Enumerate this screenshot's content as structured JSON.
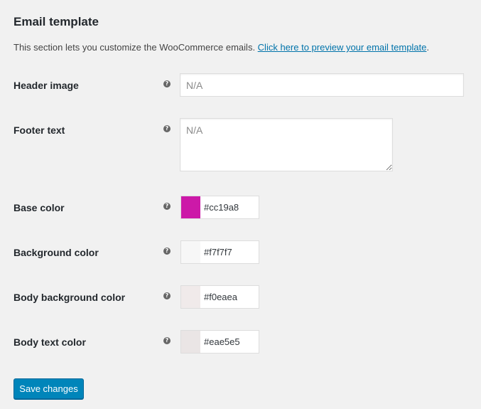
{
  "section": {
    "title": "Email template",
    "description_prefix": "This section lets you customize the WooCommerce emails. ",
    "preview_link_text": "Click here to preview your email template",
    "description_suffix": "."
  },
  "fields": {
    "header_image": {
      "label": "Header image",
      "help": "?",
      "placeholder": "N/A",
      "value": ""
    },
    "footer_text": {
      "label": "Footer text",
      "help": "?",
      "placeholder": "N/A",
      "value": ""
    },
    "base_color": {
      "label": "Base color",
      "help": "?",
      "value": "#cc19a8",
      "swatch": "#cc19a8"
    },
    "background_color": {
      "label": "Background color",
      "help": "?",
      "value": "#f7f7f7",
      "swatch": "#f7f7f7"
    },
    "body_background_color": {
      "label": "Body background color",
      "help": "?",
      "value": "#f0eaea",
      "swatch": "#f0eaea"
    },
    "body_text_color": {
      "label": "Body text color",
      "help": "?",
      "value": "#eae5e5",
      "swatch": "#eae5e5"
    }
  },
  "actions": {
    "save_label": "Save changes"
  },
  "icons": {
    "help": "question-mark-circle-icon"
  },
  "colors": {
    "link": "#0073aa",
    "primary_button": "#0085ba"
  }
}
